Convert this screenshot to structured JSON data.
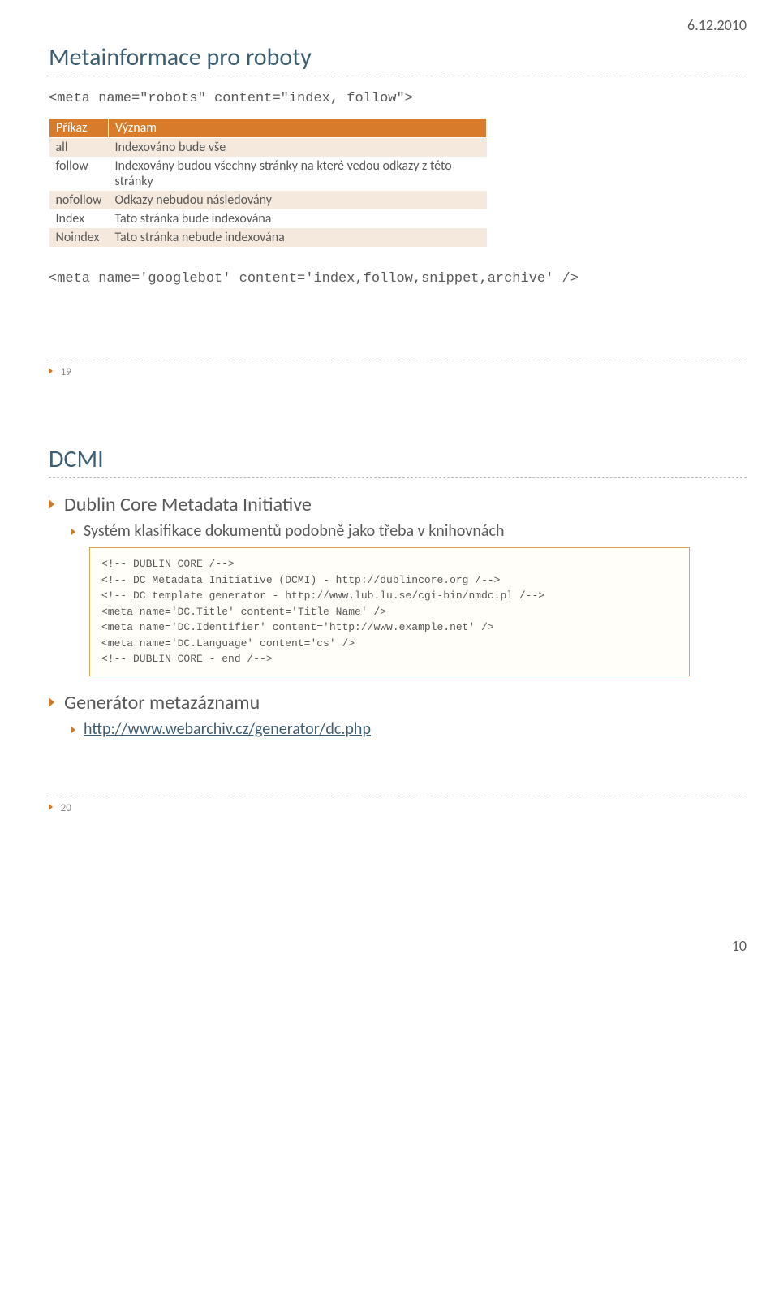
{
  "header_date": "6.12.2010",
  "footer_page": "10",
  "slide1": {
    "title": "Metainformace pro roboty",
    "code_top": "<meta name=\"robots\" content=\"index, follow\">",
    "table": {
      "headers": [
        "Příkaz",
        "Význam"
      ],
      "rows": [
        {
          "cmd": "all",
          "desc": "Indexováno bude vše"
        },
        {
          "cmd": "follow",
          "desc": "Indexovány budou všechny stránky na které vedou odkazy z této stránky"
        },
        {
          "cmd": "nofollow",
          "desc": "Odkazy nebudou následovány"
        },
        {
          "cmd": "Index",
          "desc": "Tato stránka bude indexována"
        },
        {
          "cmd": "Noindex",
          "desc": "Tato stránka nebude indexována"
        }
      ]
    },
    "code_bottom": "<meta name='googlebot' content='index,follow,snippet,archive' />",
    "num": "19"
  },
  "slide2": {
    "title": "DCMI",
    "b1": "Dublin Core Metadata Initiative",
    "b1_1": "Systém klasifikace dokumentů podobně jako třeba v knihovnách",
    "code": [
      "<!-- DUBLIN CORE /-->",
      "<!-- DC Metadata Initiative (DCMI) - http://dublincore.org /-->",
      "<!-- DC template generator - http://www.lub.lu.se/cgi-bin/nmdc.pl /-->",
      "<meta name='DC.Title' content='Title Name' />",
      "<meta name='DC.Identifier' content='http://www.example.net' />",
      "<meta name='DC.Language' content='cs' />",
      "<!-- DUBLIN CORE - end /-->"
    ],
    "b2": "Generátor metazáznamu",
    "b2_1": "http://www.webarchiv.cz/generator/dc.php",
    "num": "20"
  }
}
